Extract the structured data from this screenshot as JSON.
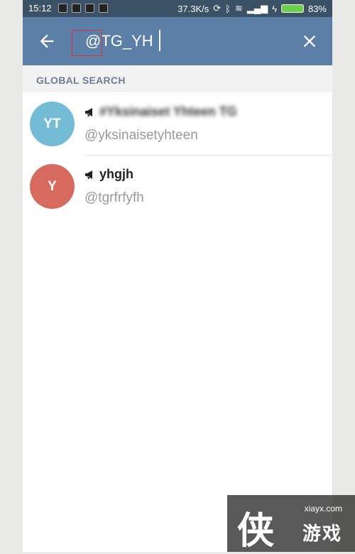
{
  "status_bar": {
    "time": "15:12",
    "network_speed": "37.3K/s",
    "battery_percent": "83%"
  },
  "toolbar": {
    "search_value": "@TG_YH",
    "background_color": "#5b7fa6"
  },
  "section": {
    "title": "GLOBAL SEARCH"
  },
  "results": [
    {
      "avatar_initials": "YT",
      "avatar_color": "#74bcd6",
      "name": "#Yksinaiset Yhteen TG",
      "username": "@yksinaisetyhteen"
    },
    {
      "avatar_initials": "Y",
      "avatar_color": "#d76a5e",
      "name": "yhgjh",
      "username": "@tgrfrfyfh"
    }
  ],
  "watermark": {
    "url": "xiayx.com",
    "glyph": "侠",
    "text": "游戏"
  }
}
